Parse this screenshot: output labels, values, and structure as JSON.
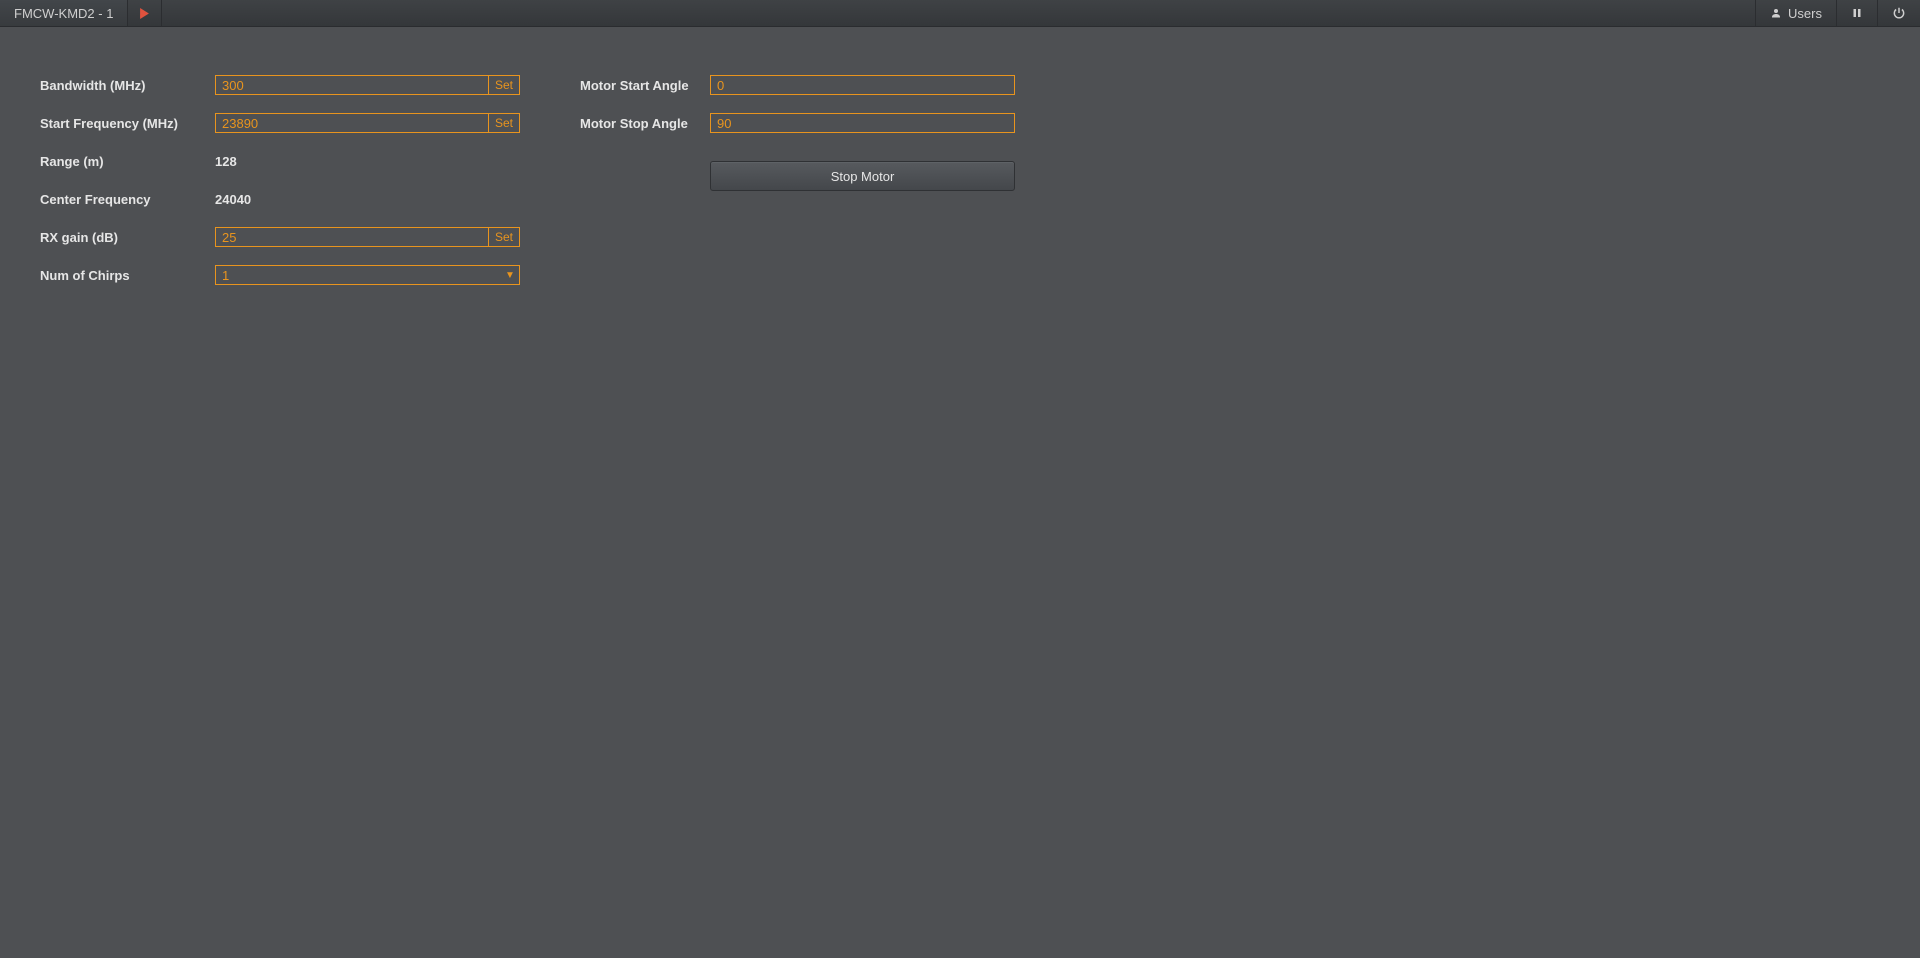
{
  "header": {
    "tab_title": "FMCW-KMD2 - 1",
    "users_label": "Users"
  },
  "left": {
    "bandwidth": {
      "label": "Bandwidth (MHz)",
      "value": "300",
      "set": "Set"
    },
    "start_freq": {
      "label": "Start Frequency (MHz)",
      "value": "23890",
      "set": "Set"
    },
    "range": {
      "label": "Range (m)",
      "value": "128"
    },
    "center_freq": {
      "label": "Center Frequency",
      "value": "24040"
    },
    "rx_gain": {
      "label": "RX gain (dB)",
      "value": "25",
      "set": "Set"
    },
    "num_chirps": {
      "label": "Num of Chirps",
      "value": "1"
    }
  },
  "right": {
    "motor_start": {
      "label": "Motor Start Angle",
      "value": "0"
    },
    "motor_stop": {
      "label": "Motor Stop Angle",
      "value": "90"
    },
    "stop_motor_btn": "Stop Motor"
  }
}
